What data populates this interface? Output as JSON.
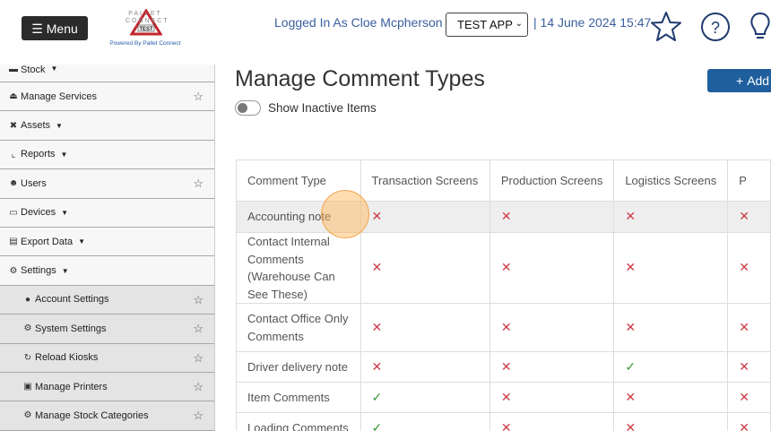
{
  "header": {
    "menu_label": "Menu",
    "logo_brand": "PALLET CONNECT",
    "logo_badge": "TEST",
    "powered_by": "Powered By Pallet Connect",
    "logged_in": "Logged In As Cloe Mcpherson |",
    "app_select": "TEST APP",
    "datetime": "| 14 June 2024 15:47",
    "icons": [
      "star-icon",
      "help-icon",
      "lightbulb-icon"
    ]
  },
  "sidebar": {
    "items": [
      {
        "label": "Stock",
        "icon": "stock-icon",
        "caret": true,
        "star": false,
        "sub": false
      },
      {
        "label": "Manage Services",
        "icon": "services-icon",
        "caret": false,
        "star": true,
        "sub": false
      },
      {
        "label": "Assets",
        "icon": "tools-icon",
        "caret": true,
        "star": false,
        "sub": false
      },
      {
        "label": "Reports",
        "icon": "chart-icon",
        "caret": true,
        "star": false,
        "sub": false
      },
      {
        "label": "Users",
        "icon": "users-icon",
        "caret": false,
        "star": true,
        "sub": false
      },
      {
        "label": "Devices",
        "icon": "monitor-icon",
        "caret": true,
        "star": false,
        "sub": false
      },
      {
        "label": "Export Data",
        "icon": "export-icon",
        "caret": true,
        "star": false,
        "sub": false
      },
      {
        "label": "Settings",
        "icon": "cogs-icon",
        "caret": true,
        "star": false,
        "sub": false
      },
      {
        "label": "Account Settings",
        "icon": "user-icon",
        "caret": false,
        "star": true,
        "sub": true
      },
      {
        "label": "System Settings",
        "icon": "cogs-icon",
        "caret": false,
        "star": true,
        "sub": true
      },
      {
        "label": "Reload Kiosks",
        "icon": "refresh-icon",
        "caret": false,
        "star": true,
        "sub": true
      },
      {
        "label": "Manage Printers",
        "icon": "printer-icon",
        "caret": false,
        "star": true,
        "sub": true
      },
      {
        "label": "Manage Stock Categories",
        "icon": "cogs-icon",
        "caret": false,
        "star": true,
        "sub": true
      }
    ]
  },
  "main": {
    "title": "Manage Comment Types",
    "add_label": "Add",
    "toggle_label": "Show Inactive Items",
    "columns": [
      "Comment Type",
      "Transaction Screens",
      "Production Screens",
      "Logistics Screens",
      "P"
    ],
    "rows": [
      {
        "name": "Accounting note",
        "vals": [
          "x",
          "x",
          "x",
          "x"
        ],
        "highlight": true
      },
      {
        "name": "Contact Internal Comments (Warehouse Can See These)",
        "vals": [
          "x",
          "x",
          "x",
          "x"
        ],
        "highlight": false
      },
      {
        "name": "Contact Office Only Comments",
        "vals": [
          "x",
          "x",
          "x",
          "x"
        ],
        "highlight": false
      },
      {
        "name": "Driver delivery note",
        "vals": [
          "x",
          "x",
          "check",
          "x"
        ],
        "highlight": false
      },
      {
        "name": "Item Comments",
        "vals": [
          "check",
          "x",
          "x",
          "x"
        ],
        "highlight": false
      },
      {
        "name": "Loading Comments",
        "vals": [
          "check",
          "x",
          "x",
          "x"
        ],
        "highlight": false
      }
    ]
  }
}
